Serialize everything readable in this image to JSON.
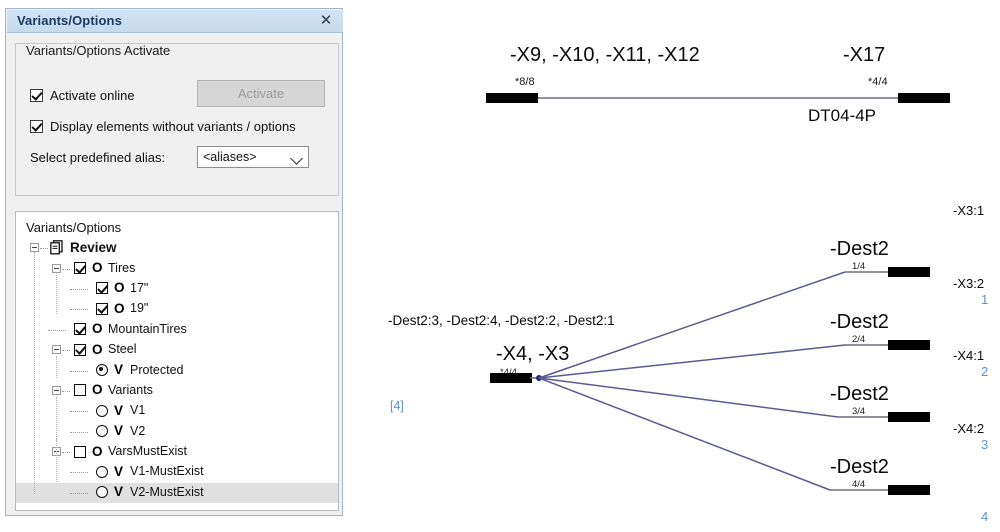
{
  "panel": {
    "title": "Variants/Options",
    "close_icon": "close-icon",
    "group": {
      "legend": "Variants/Options Activate",
      "checkboxes": [
        {
          "label": "Activate online",
          "checked": true
        },
        {
          "label": "Display elements without variants / options",
          "checked": true
        }
      ],
      "activate_button": {
        "label": "Activate",
        "disabled": true
      },
      "alias": {
        "label": "Select predefined alias:",
        "value": "<aliases>",
        "chevron_icon": "chevron-down-icon"
      }
    },
    "tree": {
      "header": "Variants/Options",
      "nodes": [
        {
          "label": "Review",
          "depth": 0,
          "control": "none",
          "marker": "",
          "icon": "document-icon",
          "expander": "minus",
          "bold": true,
          "selected": false
        },
        {
          "label": "Tires",
          "depth": 1,
          "control": "checkbox",
          "checked": true,
          "marker": "O",
          "expander": "minus",
          "bold": false,
          "selected": false
        },
        {
          "label": "17\"",
          "depth": 2,
          "control": "checkbox",
          "checked": true,
          "marker": "O",
          "expander": "none",
          "bold": false,
          "selected": false
        },
        {
          "label": "19\"",
          "depth": 2,
          "control": "checkbox",
          "checked": true,
          "marker": "O",
          "expander": "none",
          "bold": false,
          "selected": false
        },
        {
          "label": "MountainTires",
          "depth": 1,
          "control": "checkbox",
          "checked": true,
          "marker": "O",
          "expander": "none",
          "bold": false,
          "selected": false
        },
        {
          "label": "Steel",
          "depth": 1,
          "control": "checkbox",
          "checked": true,
          "marker": "O",
          "expander": "minus",
          "bold": false,
          "selected": false
        },
        {
          "label": "Protected",
          "depth": 2,
          "control": "radio",
          "checked": true,
          "marker": "V",
          "expander": "none",
          "bold": false,
          "selected": false
        },
        {
          "label": "Variants",
          "depth": 1,
          "control": "checkbox",
          "checked": false,
          "marker": "O",
          "expander": "minus",
          "bold": false,
          "selected": false
        },
        {
          "label": "V1",
          "depth": 2,
          "control": "radio",
          "checked": false,
          "marker": "V",
          "expander": "none",
          "bold": false,
          "selected": false
        },
        {
          "label": "V2",
          "depth": 2,
          "control": "radio",
          "checked": false,
          "marker": "V",
          "expander": "none",
          "bold": false,
          "selected": false
        },
        {
          "label": "VarsMustExist",
          "depth": 1,
          "control": "checkbox",
          "checked": false,
          "marker": "O",
          "expander": "minus",
          "bold": false,
          "selected": false
        },
        {
          "label": "V1-MustExist",
          "depth": 2,
          "control": "radio",
          "checked": false,
          "marker": "V",
          "expander": "none",
          "bold": false,
          "selected": false
        },
        {
          "label": "V2-MustExist",
          "depth": 2,
          "control": "radio",
          "checked": false,
          "marker": "V",
          "expander": "none",
          "bold": false,
          "selected": true
        }
      ]
    }
  },
  "diagram": {
    "top_connector": {
      "left_label": "-X9, -X10, -X11, -X12",
      "left_pincount": "*8/8",
      "right_label": "-X17",
      "right_pincount": "*4/4",
      "part_number": "DT04-4P"
    },
    "fan": {
      "source_label": "-X4, -X3",
      "source_pincount": "*4/4",
      "dest_list": "-Dest2:3, -Dest2:4, -Dest2:2, -Dest2:1",
      "wire_count": "[4]",
      "branches": [
        {
          "label": "-Dest2",
          "pin": "1/4"
        },
        {
          "label": "-Dest2",
          "pin": "2/4"
        },
        {
          "label": "-Dest2",
          "pin": "3/4"
        },
        {
          "label": "-Dest2",
          "pin": "4/4"
        }
      ]
    },
    "right_column": {
      "pins": [
        "-X3:1",
        "-X3:2",
        "-X4:1",
        "-X4:2"
      ],
      "counts": [
        "1",
        "2",
        "3",
        "4"
      ]
    },
    "colors": {
      "wire": "#5a5a96",
      "terminal": "#000000",
      "accent_blue": "#5b93d6"
    }
  }
}
